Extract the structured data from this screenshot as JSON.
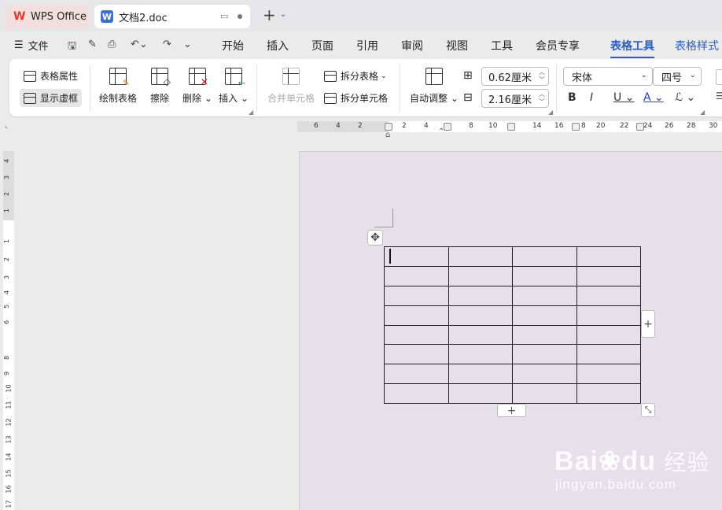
{
  "titlebar": {
    "app_tab": "WPS Office",
    "doc_tab": "文档2.doc"
  },
  "menu": {
    "file": "文件",
    "tabs": [
      "开始",
      "插入",
      "页面",
      "引用",
      "审阅",
      "视图",
      "工具",
      "会员专享",
      "表格工具",
      "表格样式"
    ],
    "active_tab": "表格工具"
  },
  "ribbon": {
    "table_props": "表格属性",
    "show_grid": "显示虚框",
    "draw_table": "绘制表格",
    "erase": "擦除",
    "delete": "删除",
    "insert": "插入",
    "merge_cells": "合并单元格",
    "split_table": "拆分表格",
    "split_cells": "拆分单元格",
    "auto_fit": "自动调整",
    "row_height": "0.62厘米",
    "col_width": "2.16厘米",
    "font_name": "宋体",
    "font_size": "四号"
  },
  "hruler": {
    "labels": [
      "6",
      "4",
      "2",
      "2",
      "4",
      "8",
      "10",
      "14",
      "16",
      "8",
      "20",
      "22",
      "24",
      "26",
      "28",
      "30"
    ]
  },
  "vruler": {
    "labels": [
      "4",
      "3",
      "2",
      "1",
      "1",
      "2",
      "3",
      "4",
      "5",
      "6",
      "8",
      "9",
      "10",
      "11",
      "12",
      "13",
      "14",
      "15",
      "16",
      "17"
    ]
  },
  "table": {
    "rows": 8,
    "cols": 4
  },
  "watermark": {
    "logo_a": "Bai",
    "logo_b": "du",
    "logo_cn": "经验",
    "url": "jingyan.baidu.com"
  },
  "colors": {
    "accent": "#2b5ec0",
    "page": "#e6e0ea",
    "wps_red": "#e03b2f"
  }
}
